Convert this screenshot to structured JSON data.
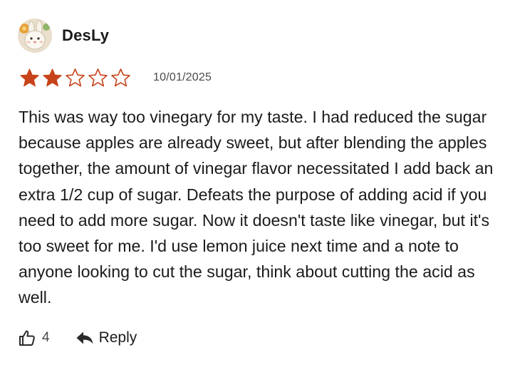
{
  "review": {
    "author": "DesLy",
    "avatar_icon": "bunny-avatar-icon",
    "rating": {
      "value": 2,
      "max": 5,
      "filled_color": "#c7431a",
      "empty_color": "#c7431a"
    },
    "date": "10/01/2025",
    "text": "This was way too vinegary for my taste. I had reduced the sugar because apples are already sweet, but after blending the apples together, the amount of vinegar flavor necessitated I add back an extra 1/2 cup of sugar. Defeats the purpose of adding acid if you need to add more sugar. Now it doesn't taste like vinegar, but it's too sweet for me. I'd use lemon juice next time and a note to anyone looking to cut the sugar, think about cutting the acid as well.",
    "actions": {
      "like_icon": "thumbs-up-icon",
      "like_count": "4",
      "reply_icon": "reply-arrow-icon",
      "reply_label": "Reply"
    }
  }
}
